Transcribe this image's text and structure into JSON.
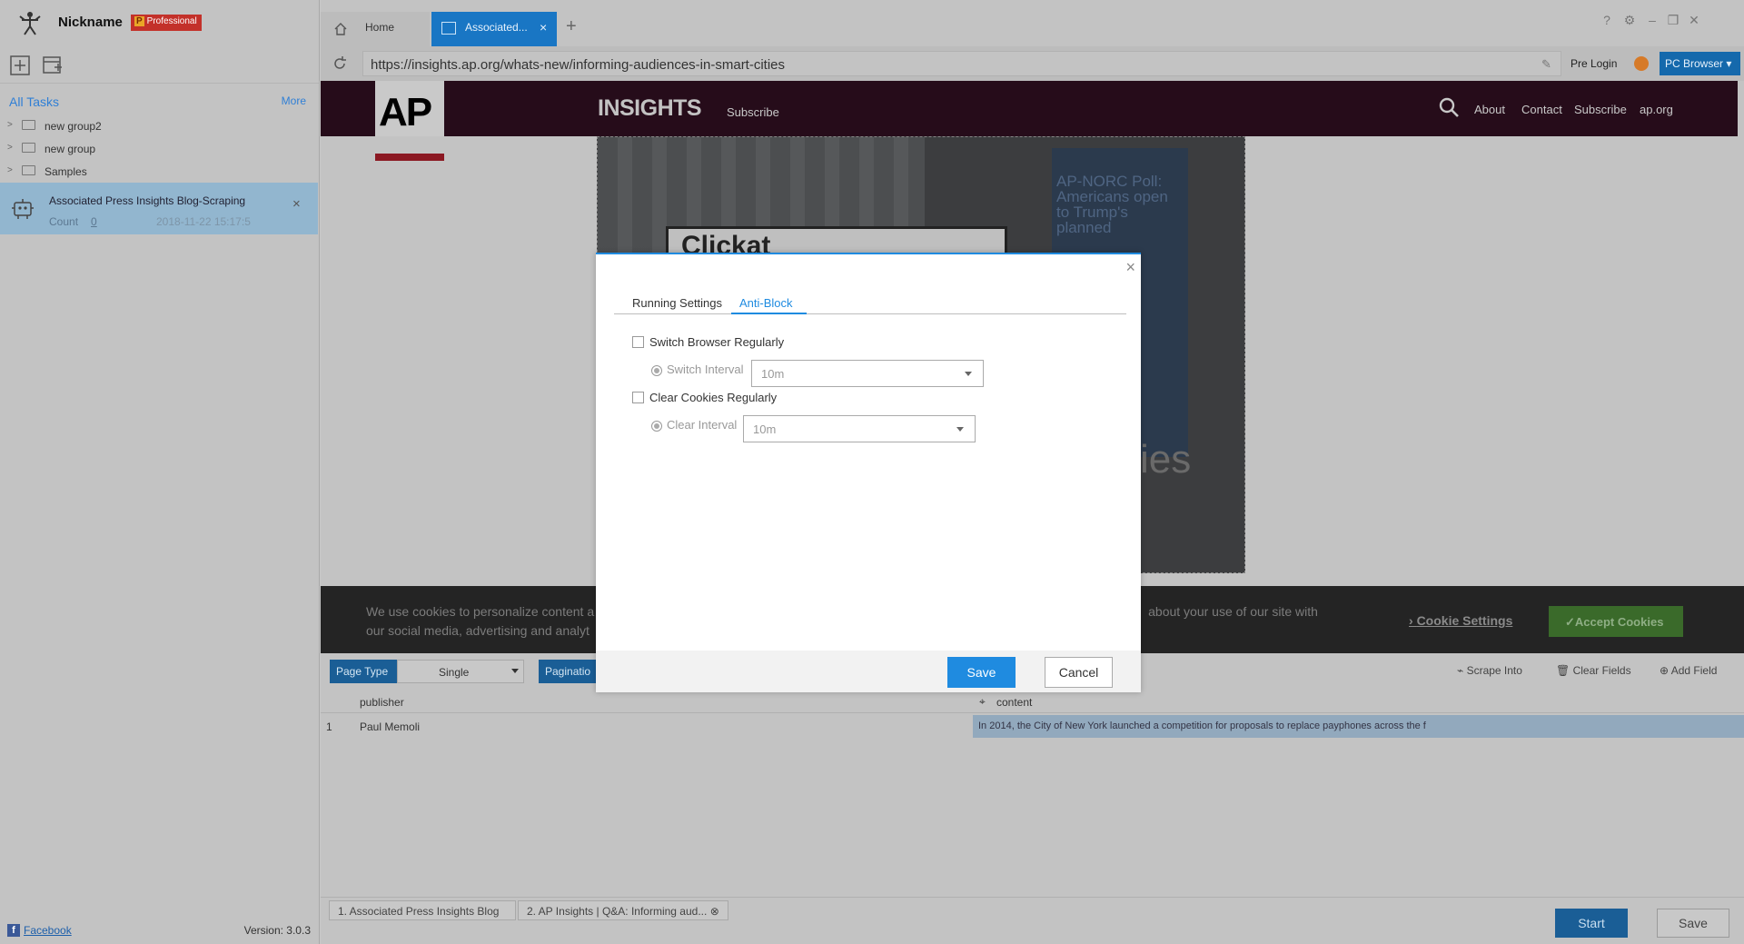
{
  "sidebar": {
    "nickname": "Nickname",
    "badge_letter": "P",
    "badge_text": "Professional",
    "all_tasks": "All Tasks",
    "more": "More",
    "groups": [
      {
        "label": "new group2"
      },
      {
        "label": "new group"
      },
      {
        "label": "Samples"
      }
    ],
    "task": {
      "title": "Associated Press Insights Blog-Scraping",
      "count_label": "Count",
      "count_value": "0",
      "date": "2018-11-22 15:17:5"
    },
    "facebook": "Facebook",
    "version": "Version: 3.0.3"
  },
  "tabs": {
    "home": "Home",
    "active": "Associated...",
    "add": "+"
  },
  "address": {
    "url": "https://insights.ap.org/whats-new/informing-audiences-in-smart-cities",
    "pre_login": "Pre Login",
    "browser": "PC Browser ▾"
  },
  "webpage": {
    "logo": "AP",
    "brand": "INSIGHTS",
    "subscribe": "Subscribe",
    "nav": [
      "About",
      "Contact",
      "Subscribe",
      "ap.org"
    ],
    "hero_sign": "Clickat",
    "hero_poster": "AP-NORC Poll: Americans open to Trump's planned",
    "hero_cities": "cies",
    "cookie_text_1": "We use cookies to personalize content a",
    "cookie_text_1b": "about your use of our site with",
    "cookie_text_2": "our social media, advertising and analyt",
    "cookie_settings": "Cookie Settings",
    "accept": "✓Accept Cookies"
  },
  "extract_toolbar": {
    "page_type_label": "Page Type",
    "page_type_value": "Single",
    "pagination_label": "Paginatio",
    "actions": [
      "Scrape Into",
      "Clear Fields",
      "Add Field"
    ]
  },
  "grid": {
    "columns": [
      "publisher",
      "content"
    ],
    "rows": [
      {
        "index": "1",
        "publisher": "Paul Memoli",
        "content": "In 2014, the City of New York launched a competition for proposals to replace payphones across the f"
      }
    ]
  },
  "bottom": {
    "tabs": [
      "1. Associated Press Insights Blog",
      "2. AP Insights | Q&A: Informing aud..."
    ],
    "start": "Start",
    "save": "Save"
  },
  "modal": {
    "tab_running": "Running Settings",
    "tab_antiblock": "Anti-Block",
    "switch_browser": "Switch Browser Regularly",
    "switch_interval_label": "Switch Interval",
    "switch_interval_value": "10m",
    "clear_cookies": "Clear Cookies Regularly",
    "clear_interval_label": "Clear Interval",
    "clear_interval_value": "10m",
    "save": "Save",
    "cancel": "Cancel",
    "close": "×"
  }
}
